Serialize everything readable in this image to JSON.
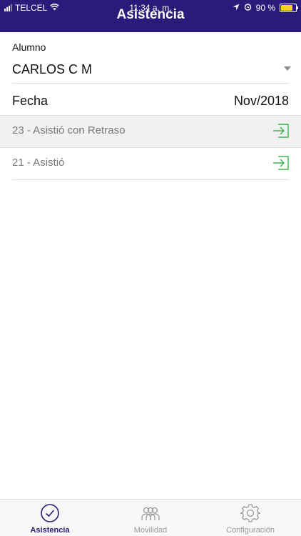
{
  "status_bar": {
    "carrier": "TELCEL",
    "time": "11:34 a. m.",
    "battery": "90 %",
    "battery_level": 0.9,
    "battery_color": "#f7d21a"
  },
  "header": {
    "title": "Asistencia",
    "background": "#2a1a7a"
  },
  "student": {
    "label": "Alumno",
    "value": "CARLOS C M"
  },
  "date": {
    "label": "Fecha",
    "value": "Nov/2018"
  },
  "records": [
    {
      "text": "23 - Asistió con Retraso",
      "icon": "enter-icon"
    },
    {
      "text": "21 - Asistió",
      "icon": "enter-icon"
    }
  ],
  "tabs": [
    {
      "label": "Asistencia",
      "icon": "checkmark-circle-icon",
      "active": true
    },
    {
      "label": "Movilidad",
      "icon": "people-icon",
      "active": false
    },
    {
      "label": "Configuración",
      "icon": "gear-icon",
      "active": false
    }
  ],
  "colors": {
    "accent": "#2a1a7a",
    "icon_green": "#39b54a"
  }
}
